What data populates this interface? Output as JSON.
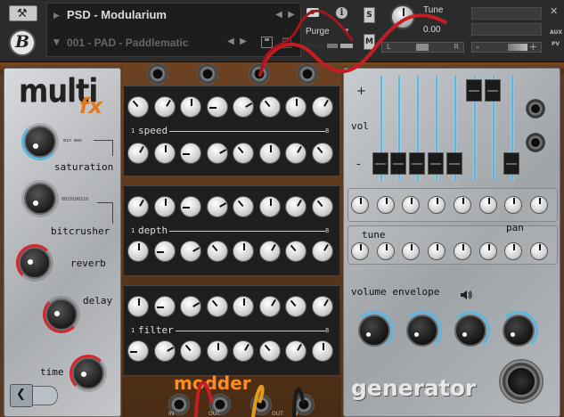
{
  "header": {
    "instrument_name": "PSD - Modularium",
    "preset_name": "001 - PAD - Paddlematic",
    "purge_label": "Purge",
    "tune_label": "Tune",
    "tune_value": "0.00",
    "solo_label": "S",
    "mute_label": "M",
    "pan_left": "L",
    "pan_right": "R",
    "aux_label": "AUX",
    "pv_label": "PV",
    "vol_minus": "-",
    "vol_plus": "+",
    "logo_letter": "B"
  },
  "multifx": {
    "title_main": "multi",
    "title_sub": "fx",
    "saturation_label": "saturation",
    "saturation_micro": "min max",
    "bitcrusher_label": "bitcrusher",
    "bitcrusher_micro": "0010100110",
    "reverb_label": "reverb",
    "delay_label": "delay",
    "time_label": "time"
  },
  "modder": {
    "title": "modder",
    "speed_label": "speed",
    "depth_label": "depth",
    "filter_label": "filter",
    "range_start": "1",
    "range_end": "8",
    "bottom_labels": [
      "IN",
      "OUT",
      "OUT",
      "IN"
    ]
  },
  "generator": {
    "title": "generator",
    "vol_label": "vol",
    "plus_label": "+",
    "minus_label": "-",
    "tune_label": "tune",
    "pan_label": "pan",
    "env_label": "volume envelope"
  },
  "colors": {
    "accent_blue": "#5bb7e0",
    "accent_red": "#d7262c",
    "modder_orange": "#ff8a1e"
  }
}
